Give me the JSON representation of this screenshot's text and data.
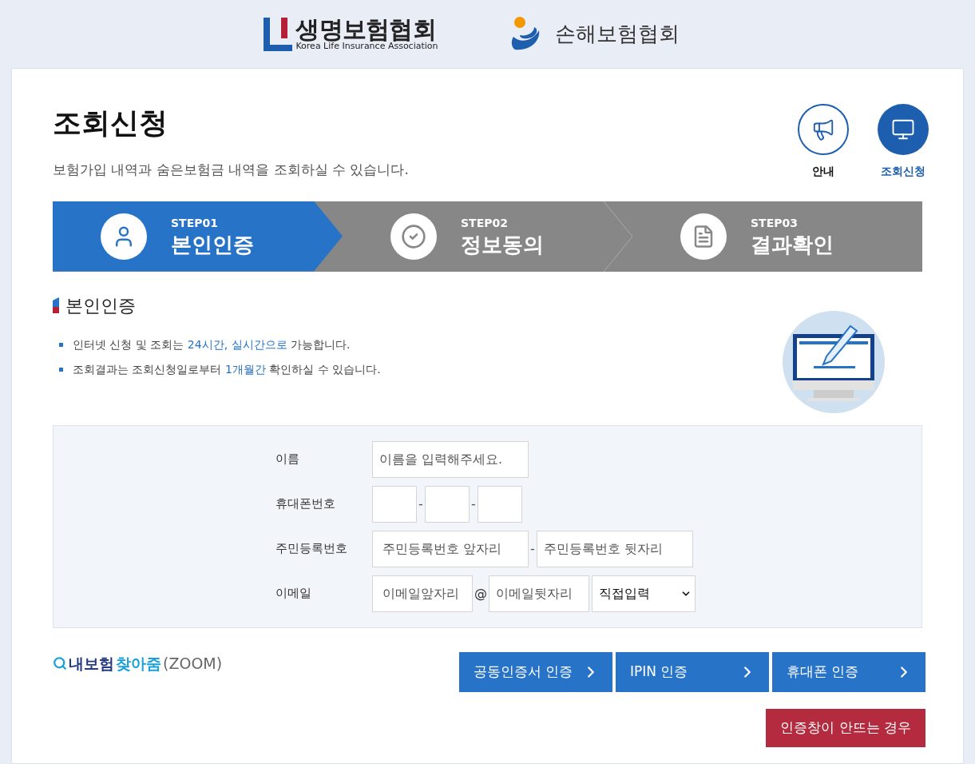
{
  "header": {
    "logos": [
      {
        "kind": "life",
        "title": "생명보험협회",
        "subtitle": "Korea Life Insurance Association"
      },
      {
        "kind": "nonlife",
        "title": "손해보험협회"
      }
    ]
  },
  "page": {
    "title": "조회신청",
    "subtitle": "보험가입 내역과 숨은보험금 내역을 조회하실 수 있습니다."
  },
  "nav": [
    {
      "kind": "notice",
      "label": "안내",
      "selected": false
    },
    {
      "kind": "inquiry",
      "label": "조회신청",
      "selected": true
    }
  ],
  "steps": [
    {
      "kind": "user",
      "step": "STEP01",
      "label": "본인인증",
      "selected": true
    },
    {
      "kind": "check",
      "step": "STEP02",
      "label": "정보동의",
      "selected": false
    },
    {
      "kind": "document",
      "step": "STEP03",
      "label": "결과확인",
      "selected": false
    }
  ],
  "section": {
    "title": "본인인증",
    "bullets": [
      [
        {
          "text": "인터넷 신청 및 조회는 ",
          "highlight": false
        },
        {
          "text": "24시간, 실시간으로",
          "highlight": true
        },
        {
          "text": " 가능합니다.",
          "highlight": false
        }
      ],
      [
        {
          "text": "조회결과는 조회신청일로부터 ",
          "highlight": false
        },
        {
          "text": "1개월간",
          "highlight": true
        },
        {
          "text": " 확인하실 수 있습니다.",
          "highlight": false
        }
      ]
    ]
  },
  "form": [
    {
      "kind": "name",
      "label": "이름",
      "placeholder": "이름을 입력해주세요."
    },
    {
      "kind": "phone",
      "label": "휴대폰번호",
      "separators": [
        "-",
        "-"
      ]
    },
    {
      "kind": "rrn",
      "label": "주민등록번호",
      "placeholders": [
        "주민등록번호 앞자리",
        "주민등록번호 뒷자리"
      ],
      "separator": "-"
    },
    {
      "kind": "email",
      "label": "이메일",
      "placeholders": [
        "이메일앞자리",
        "이메일뒷자리"
      ],
      "separator": "@",
      "select": "직접입력"
    }
  ],
  "zoom_link": [
    {
      "kind": "dark",
      "text": "내보험"
    },
    {
      "kind": "accent",
      "text": "찾아줌"
    },
    {
      "kind": "muted",
      "text": "(ZOOM)"
    }
  ],
  "auth_buttons": [
    "공동인증서 인증",
    "IPIN 인증",
    "휴대폰 인증"
  ],
  "help_button": "인증창이 안뜨는 경우"
}
